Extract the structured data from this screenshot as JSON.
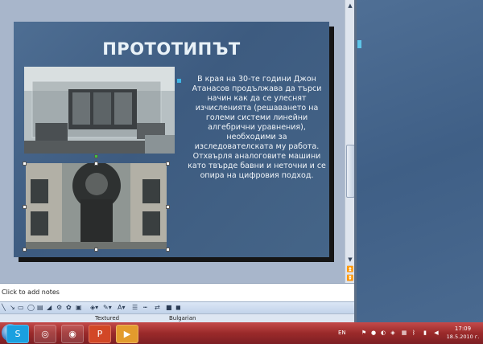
{
  "slide": {
    "title": "ПРОТОТИПЪТ",
    "bullet": "В края на 30-те години Джон Атанасов продължава да търси начин как да се улеснят изчисленията (решаването на големи системи линейни алгебрични уравнения), необходими за изследователската му работа. Отхвърля аналоговите машини като твърде бавни и неточни и се опира на цифровия подход.",
    "photo_1": "machine-photo",
    "photo_2": "monument-photo"
  },
  "notes": {
    "placeholder": "Click to add notes"
  },
  "status_bar": {
    "design": "Textured",
    "language": "Bulgarian"
  },
  "taskbar": {
    "apps": [
      "skype-icon",
      "ie-icon",
      "chrome-icon",
      "powerpoint-icon",
      "media-player-icon"
    ],
    "language": "EN",
    "time": "17:09",
    "date": "18.5.2010 г."
  },
  "colors": {
    "slide_bg": "#4a6b90",
    "title": "#e9f2f8",
    "bullet": "#3fb6e6",
    "taskbar": "#9a2a2a"
  }
}
